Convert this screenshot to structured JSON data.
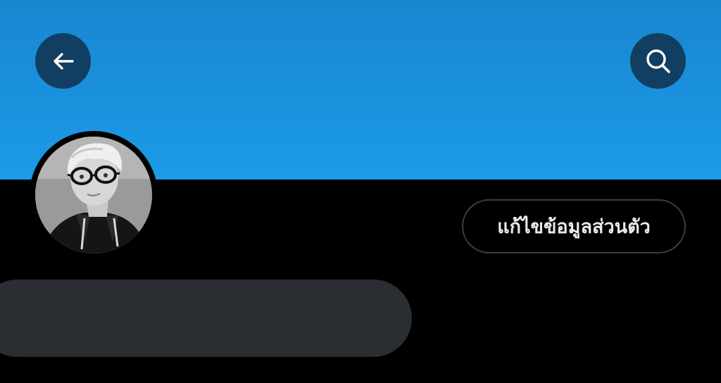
{
  "header": {
    "back_icon": "arrow-left-icon",
    "search_icon": "search-icon",
    "banner_color": "#1b95e0",
    "button_bg": "#113758"
  },
  "profile": {
    "avatar": "profile-photo",
    "edit_profile_label": "แก้ไขข้อมูลส่วนตัว"
  },
  "placeholder_color": "#2a2d31"
}
